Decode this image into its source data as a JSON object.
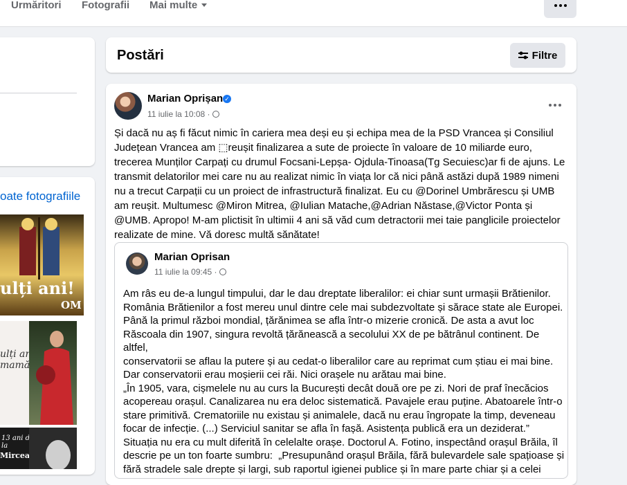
{
  "nav": {
    "tabs": [
      "Urmăritori",
      "Fotografii",
      "Mai multe"
    ],
    "more_icon": "ellipsis-icon"
  },
  "left": {
    "all_photos_link": "oate fotografiile",
    "photo1_big": "ulți ani!",
    "photo1_small": "OM",
    "photo2_text": "ulți ani,\nmamă!",
    "photo4_text": "13 ani de la",
    "photo4_name": "Mircea Diaconu"
  },
  "posts": {
    "title": "Postări",
    "filter_label": "Filtre",
    "filter_icon": "sliders-icon"
  },
  "post": {
    "author": "Marian Oprișan",
    "verified_icon": "verified-badge-icon",
    "date": "11 iulie la 10:08 ·",
    "privacy_icon": "globe-icon",
    "text": "Și dacă nu aș fi făcut nimic în cariera mea deși eu și echipa mea de la PSD Vrancea și Consiliul Județean Vrancea am ⬚reușit finalizarea a sute de proiecte în valoare de 10 miliarde euro, trecerea Munților Carpați cu drumul Focsani-Lepșa- Ojdula-Tinoasa(Tg Secuiesc)ar fi de ajuns. Le transmit delatorilor mei care nu au realizat nimic în viața lor că nici până astăzi după 1989 nimeni nu a trecut Carpații cu un proiect de infrastructură finalizat. Eu cu @Dorinel Umbrărescu și UMB am reușit. Multumesc @Miron Mitrea, @Iulian Matache,@Adrian Năstase,@Victor Ponta și @UMB. Apropo! M-am plictisit în ultimii 4 ani să văd cum detractorii mei taie panglicile proiectelor realizate de mine. Vă doresc multă sănătate!",
    "shared": {
      "author": "Marian Oprisan",
      "date": "11 iulie la 09:45 ·",
      "text": "Am râs eu de-a lungul timpului, dar le dau dreptate liberalilor: ei chiar sunt urmașii Brătienilor.\nRomânia Brătienilor a fost mereu unul dintre cele mai subdezvoltate și sărace state ale Europei.\nPână la primul război mondial, țărănimea se afla într-o mizerie cronică. De asta a avut loc\nRăscoala din 1907, singura revoltă țărănească a secolului XX de pe bătrânul continent. De altfel,\nconservatorii se aflau la putere și au cedat-o liberalilor care au reprimat cum știau ei mai bine.\nDar conservatorii erau moșierii cei răi. Nici orașele nu arătau mai bine.\n„În 1905, vara, cișmelele nu au curs la București decât două ore pe zi. Nori de praf înecăcios\nacopereau orașul. Canalizarea nu era deloc sistematică. Pavajele erau puține. Abatoarele într-o\nstare primitivă. Crematoriile nu existau și animalele, dacă nu erau îngropate la timp, deveneau\nfocar de infecție. (...) Serviciul sanitar se afla în fașă. Asistența publică era un deziderat.”\nSituația nu era cu mult diferită în celelalte orașe. Doctorul A. Fotino, inspectând orașul Brăila, îl\ndescrie pe un ton foarte sumbru:  „Presupunând orașul Brăila, fără bulevardele sale spațioase și\nfără stradele sale drepte și largi, sub raportul igienei publice și în mare parte chiar și a celei"
    }
  },
  "colors": {
    "page_bg": "#f0f2f5",
    "card_bg": "#ffffff",
    "link": "#0064d1",
    "secondary_text": "#65676b",
    "button_bg": "#e4e6eb",
    "verified": "#1877f2"
  }
}
